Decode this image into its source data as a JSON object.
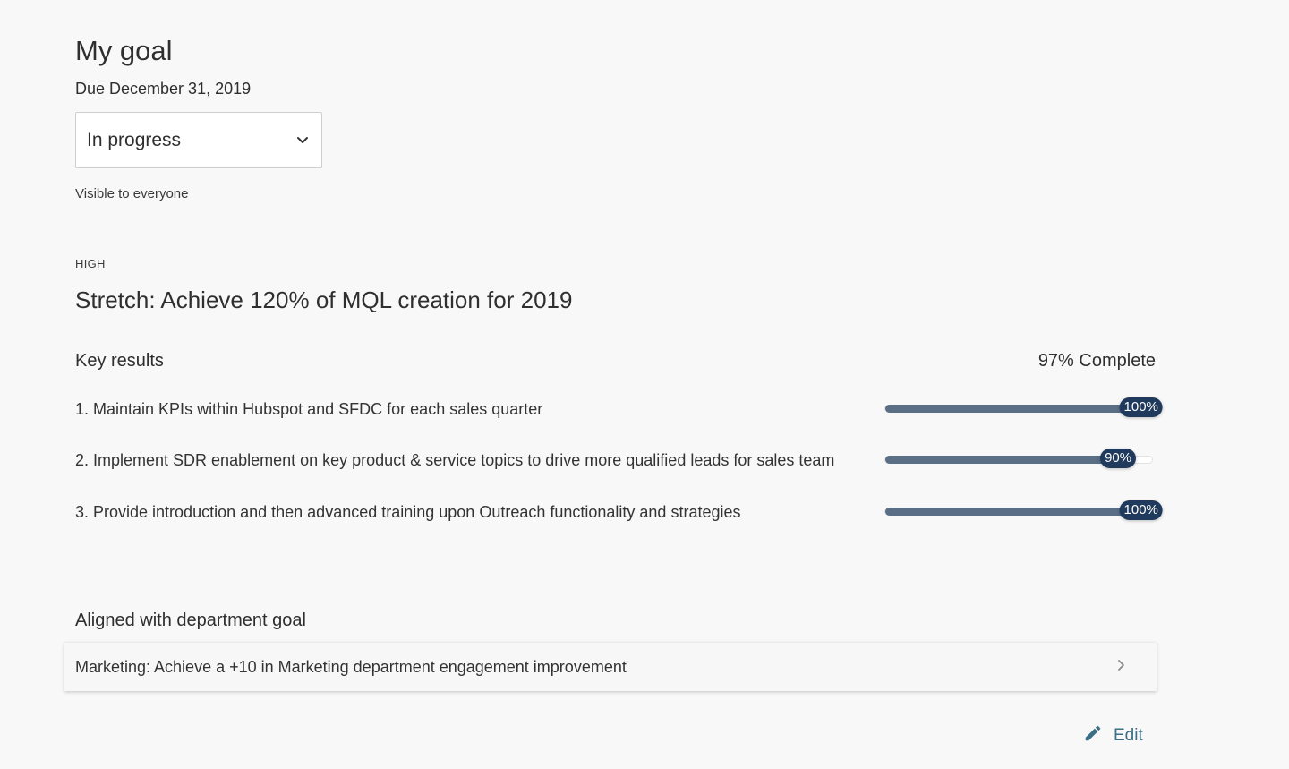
{
  "goal": {
    "title": "My goal",
    "due": "Due December 31, 2019",
    "status": "In progress",
    "visibility": "Visible to everyone",
    "priority": "HIGH",
    "name": "Stretch: Achieve 120% of MQL creation for 2019"
  },
  "key_results": {
    "heading": "Key results",
    "complete": "97% Complete",
    "items": [
      {
        "text": "1. Maintain KPIs within Hubspot and SFDC for each sales quarter",
        "progress": 100,
        "label": "100%"
      },
      {
        "text": "2. Implement SDR enablement on key product & service topics to drive more qualified leads for sales team",
        "progress": 90,
        "label": "90%"
      },
      {
        "text": "3. Provide introduction and then advanced training upon Outreach functionality and strategies",
        "progress": 100,
        "label": "100%"
      }
    ]
  },
  "aligned": {
    "heading": "Aligned with department goal",
    "goal": "Marketing: Achieve a +10 in Marketing department engagement improvement"
  },
  "actions": {
    "edit_label": "Edit"
  },
  "icons": {
    "status_dropdown": "chevron-down-icon",
    "aligned_arrow": "chevron-right-icon",
    "edit": "pencil-icon"
  },
  "colors": {
    "progress_fill": "#5a6e86",
    "progress_badge": "#1f3a5c",
    "link": "#3b6f86",
    "background": "#f8f8f8"
  }
}
